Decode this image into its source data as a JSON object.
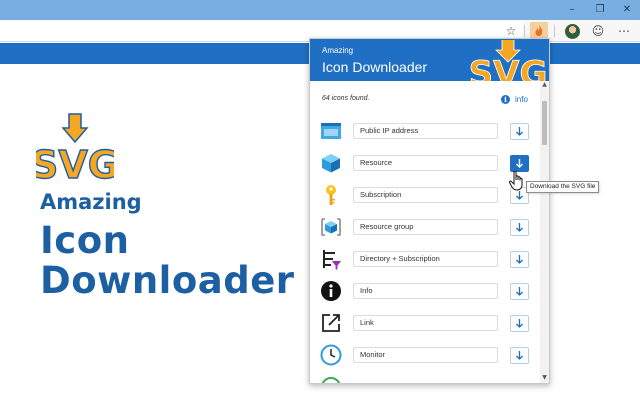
{
  "browser": {
    "window_controls": {
      "minimize": "–",
      "restore": "❐",
      "close": "✕"
    },
    "toolbar_icons": [
      "star-icon",
      "extension-icon",
      "profile-avatar",
      "emoji-icon",
      "more-icon"
    ],
    "star_glyph": "☆",
    "emoji_glyph": "☺",
    "more_glyph": "⋯"
  },
  "hero": {
    "logo_text": "SVG",
    "line1": "Amazing",
    "line2": "Icon",
    "line3": "Downloader"
  },
  "popup": {
    "header_small": "Amazing",
    "header_title": "Icon Downloader",
    "header_logo_text": "SVG",
    "count_text": "64 icons found.",
    "info_glyph": "i",
    "info_label": "info",
    "icons": [
      {
        "name": "Public IP address",
        "icon": "public-ip-address-icon",
        "active": false
      },
      {
        "name": "Resource",
        "icon": "resource-cube-icon",
        "active": true
      },
      {
        "name": "Subscription",
        "icon": "subscription-key-icon",
        "active": false
      },
      {
        "name": "Resource group",
        "icon": "resource-group-icon",
        "active": false
      },
      {
        "name": "Directory + Subscription",
        "icon": "directory-subscription-icon",
        "active": false
      },
      {
        "name": "Info",
        "icon": "info-icon",
        "active": false
      },
      {
        "name": "Link",
        "icon": "link-icon",
        "active": false
      },
      {
        "name": "Monitor",
        "icon": "monitor-clock-icon",
        "active": false
      }
    ]
  },
  "tooltip": "Download the SVG file",
  "colors": {
    "brand_blue": "#1f6fc4",
    "logo_orange": "#f5a623",
    "title_bar": "#78aee0"
  }
}
